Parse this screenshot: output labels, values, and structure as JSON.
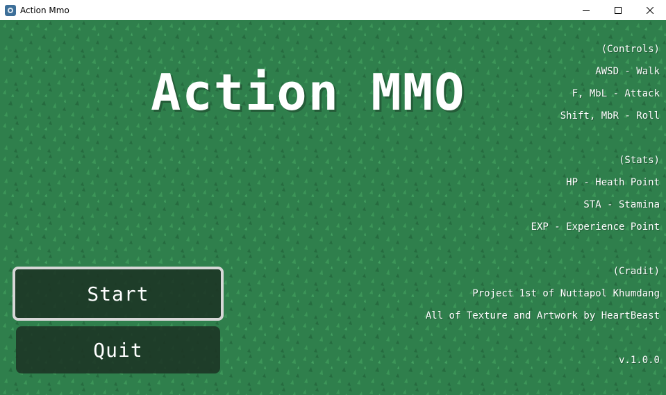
{
  "window": {
    "title": "Action Mmo",
    "controls": [
      "minimize-icon",
      "maximize-icon",
      "close-icon"
    ]
  },
  "game": {
    "title": "Action MMO",
    "version": "v.1.0.0"
  },
  "menu": {
    "start_label": "Start",
    "quit_label": "Quit"
  },
  "controls_section": {
    "header": "(Controls)",
    "lines": [
      "AWSD - Walk",
      "F, MbL - Attack",
      "Shift, MbR - Roll"
    ]
  },
  "stats_section": {
    "header": "(Stats)",
    "lines": [
      "HP - Heath Point",
      "STA - Stamina",
      "EXP - Experience Point"
    ]
  },
  "credit_section": {
    "header": "(Cradit)",
    "lines": [
      "Project 1st of Nuttapol Khumdang",
      "All of Texture and Artwork by HeartBeast"
    ]
  },
  "colors": {
    "grass": "#2f7f4c",
    "button_bg": "#1c3424",
    "button_border": "#d7d7d7",
    "text": "#ffffff"
  }
}
